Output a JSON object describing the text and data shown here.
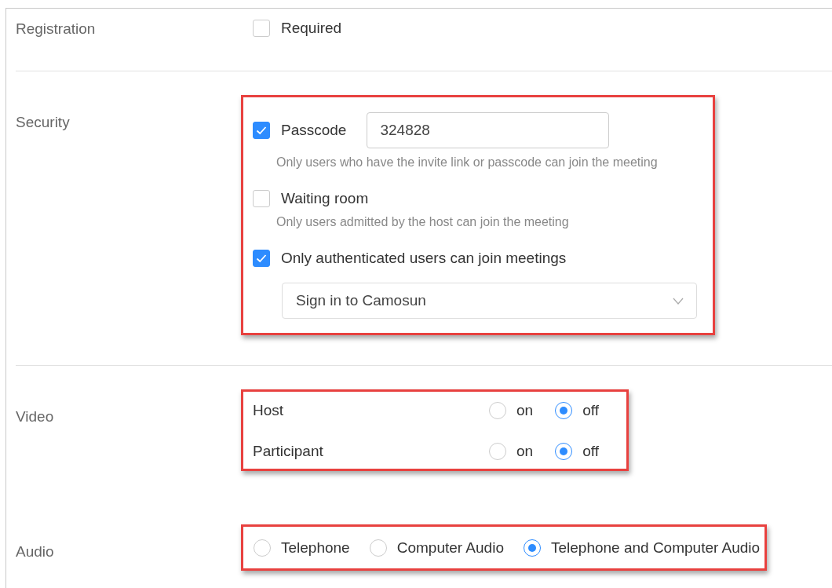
{
  "sections": [
    {
      "label": "Registration",
      "highlighted": false,
      "divider": true,
      "controls": [
        {
          "kind": "checkbox",
          "label": "Required",
          "checked": false
        }
      ]
    },
    {
      "label": "Security",
      "highlighted": true,
      "divider": true,
      "controls": [
        {
          "kind": "checkbox",
          "label": "Passcode",
          "checked": true,
          "value": "324828",
          "hint": "Only users who have the invite link or passcode can join the meeting"
        },
        {
          "kind": "checkbox",
          "label": "Waiting room",
          "checked": false,
          "hint": "Only users admitted by the host can join the meeting"
        },
        {
          "kind": "checkbox",
          "label": "Only authenticated users can join meetings",
          "checked": true
        },
        {
          "kind": "dropdown",
          "value": "Sign in to Camosun"
        }
      ]
    },
    {
      "label": "Video",
      "highlighted": true,
      "divider": false,
      "controls": [
        {
          "kind": "radio_row",
          "label": "Host",
          "options": [
            {
              "label": "on",
              "selected": false
            },
            {
              "label": "off",
              "selected": true
            }
          ]
        },
        {
          "kind": "radio_row",
          "label": "Participant",
          "options": [
            {
              "label": "on",
              "selected": false
            },
            {
              "label": "off",
              "selected": true
            }
          ]
        }
      ]
    },
    {
      "label": "Audio",
      "highlighted": true,
      "divider": false,
      "controls": [
        {
          "kind": "radio_group",
          "options": [
            {
              "label": "Telephone",
              "selected": false
            },
            {
              "label": "Computer Audio",
              "selected": false
            },
            {
              "label": "Telephone and Computer Audio",
              "selected": true
            }
          ]
        }
      ]
    }
  ]
}
